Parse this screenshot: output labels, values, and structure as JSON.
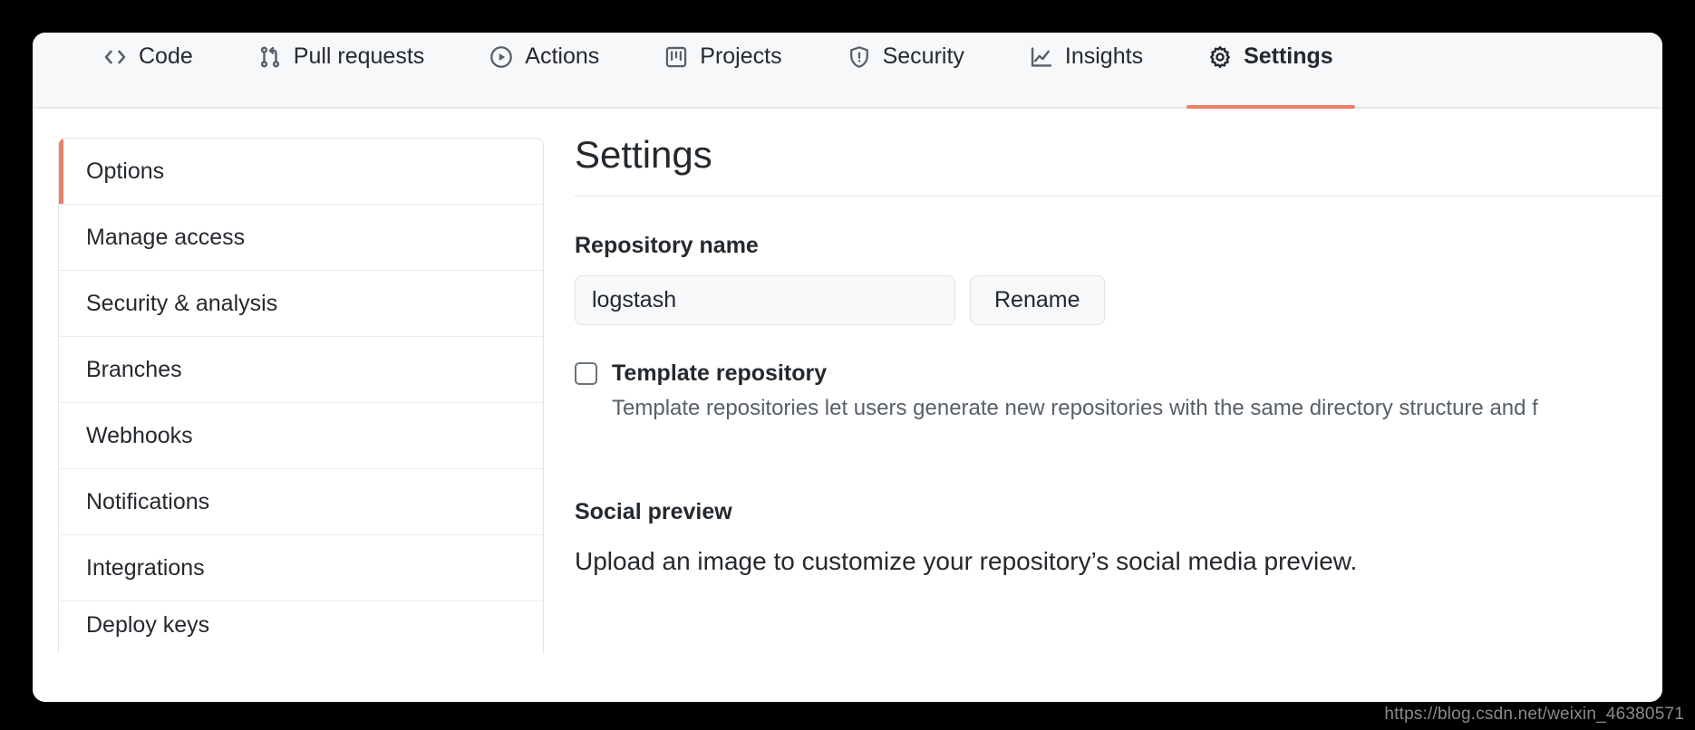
{
  "repo_nav": {
    "tabs": [
      {
        "label": "Code",
        "icon": "code-icon",
        "active": false
      },
      {
        "label": "Pull requests",
        "icon": "git-pull-request-icon",
        "active": false
      },
      {
        "label": "Actions",
        "icon": "play-circle-icon",
        "active": false
      },
      {
        "label": "Projects",
        "icon": "project-board-icon",
        "active": false
      },
      {
        "label": "Security",
        "icon": "shield-alert-icon",
        "active": false
      },
      {
        "label": "Insights",
        "icon": "graph-icon",
        "active": false
      },
      {
        "label": "Settings",
        "icon": "gear-icon",
        "active": true
      }
    ],
    "active_underline_color": "#ef7f62"
  },
  "sidebar": {
    "items": [
      {
        "label": "Options",
        "selected": true
      },
      {
        "label": "Manage access",
        "selected": false
      },
      {
        "label": "Security & analysis",
        "selected": false
      },
      {
        "label": "Branches",
        "selected": false
      },
      {
        "label": "Webhooks",
        "selected": false
      },
      {
        "label": "Notifications",
        "selected": false
      },
      {
        "label": "Integrations",
        "selected": false
      },
      {
        "label": "Deploy keys",
        "selected": false
      }
    ],
    "selected_accent_color": "#ef7f62"
  },
  "main": {
    "title": "Settings",
    "repository_name": {
      "label": "Repository name",
      "value": "logstash",
      "placeholder": "Repository name",
      "rename_button": "Rename"
    },
    "template_repository": {
      "label": "Template repository",
      "checked": false,
      "help": "Template repositories let users generate new repositories with the same directory structure and f"
    },
    "social_preview": {
      "heading": "Social preview",
      "description": "Upload an image to customize your repository’s social media preview."
    }
  },
  "watermark": {
    "text": "https://blog.csdn.net/weixin_46380571"
  }
}
